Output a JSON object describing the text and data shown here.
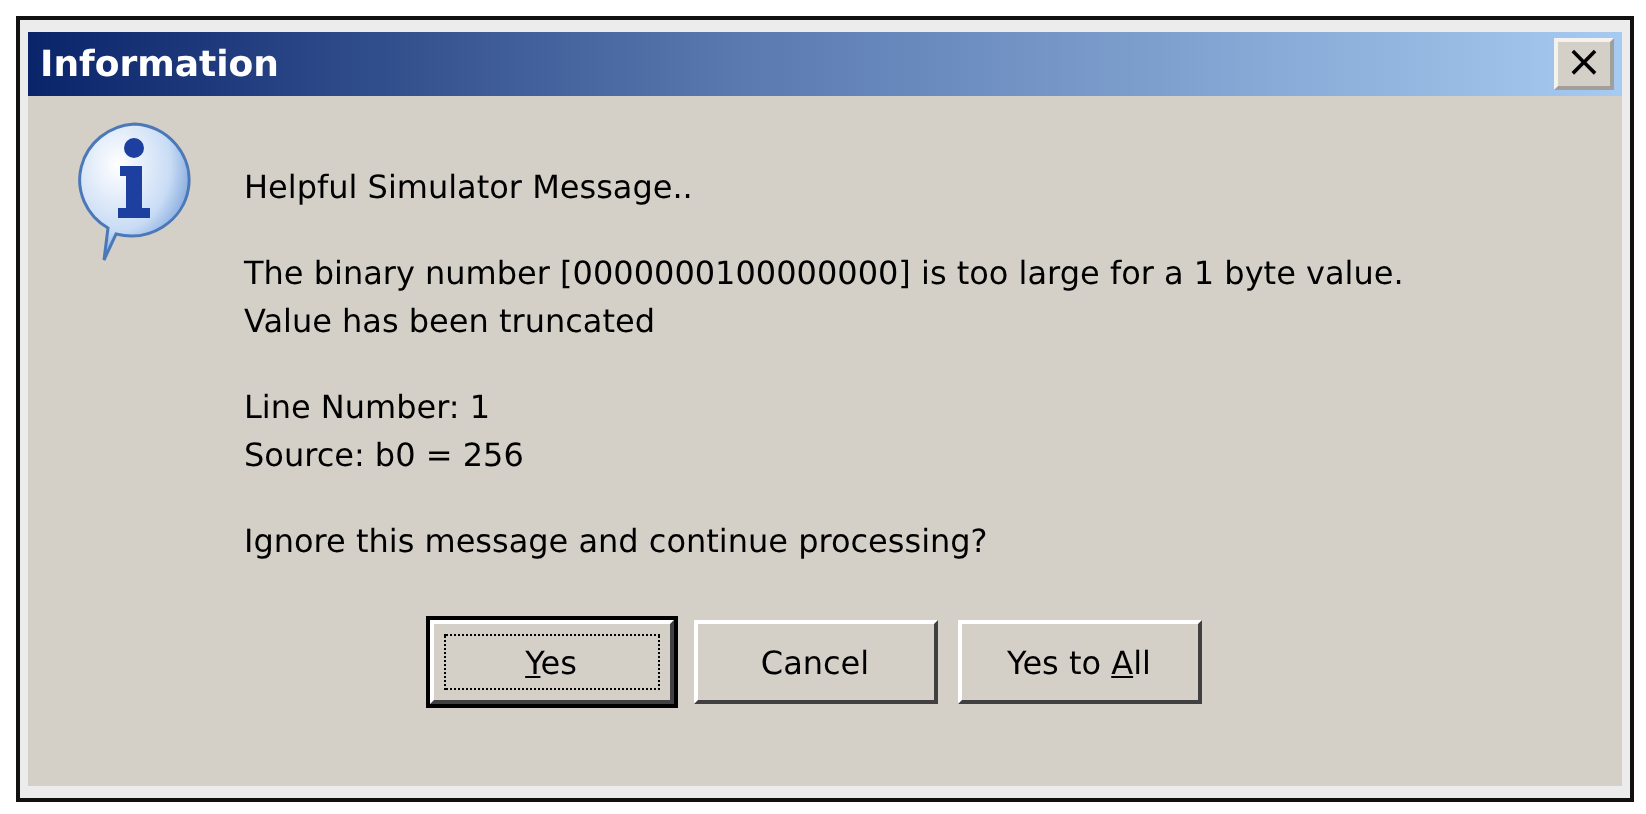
{
  "window": {
    "title": "Information",
    "close": "×"
  },
  "message": {
    "heading": "Helpful Simulator Message..",
    "paragraphs": [
      [
        "The binary number [0000000100000000] is too large for a 1 byte value.",
        "Value has been truncated"
      ],
      [
        "Line Number: 1",
        "Source: b0 = 256"
      ],
      [
        "Ignore this message and continue processing?"
      ]
    ]
  },
  "buttons": [
    {
      "label_parts": [
        {
          "text": "Y",
          "underlined": true
        },
        {
          "text": "es",
          "underlined": false
        }
      ],
      "default": true
    },
    {
      "label_parts": [
        {
          "text": "Cancel",
          "underlined": false
        }
      ],
      "default": false
    },
    {
      "label_parts": [
        {
          "text": "Yes to ",
          "underlined": false
        },
        {
          "text": "A",
          "underlined": true
        },
        {
          "text": "ll",
          "underlined": false
        }
      ],
      "default": false
    }
  ]
}
